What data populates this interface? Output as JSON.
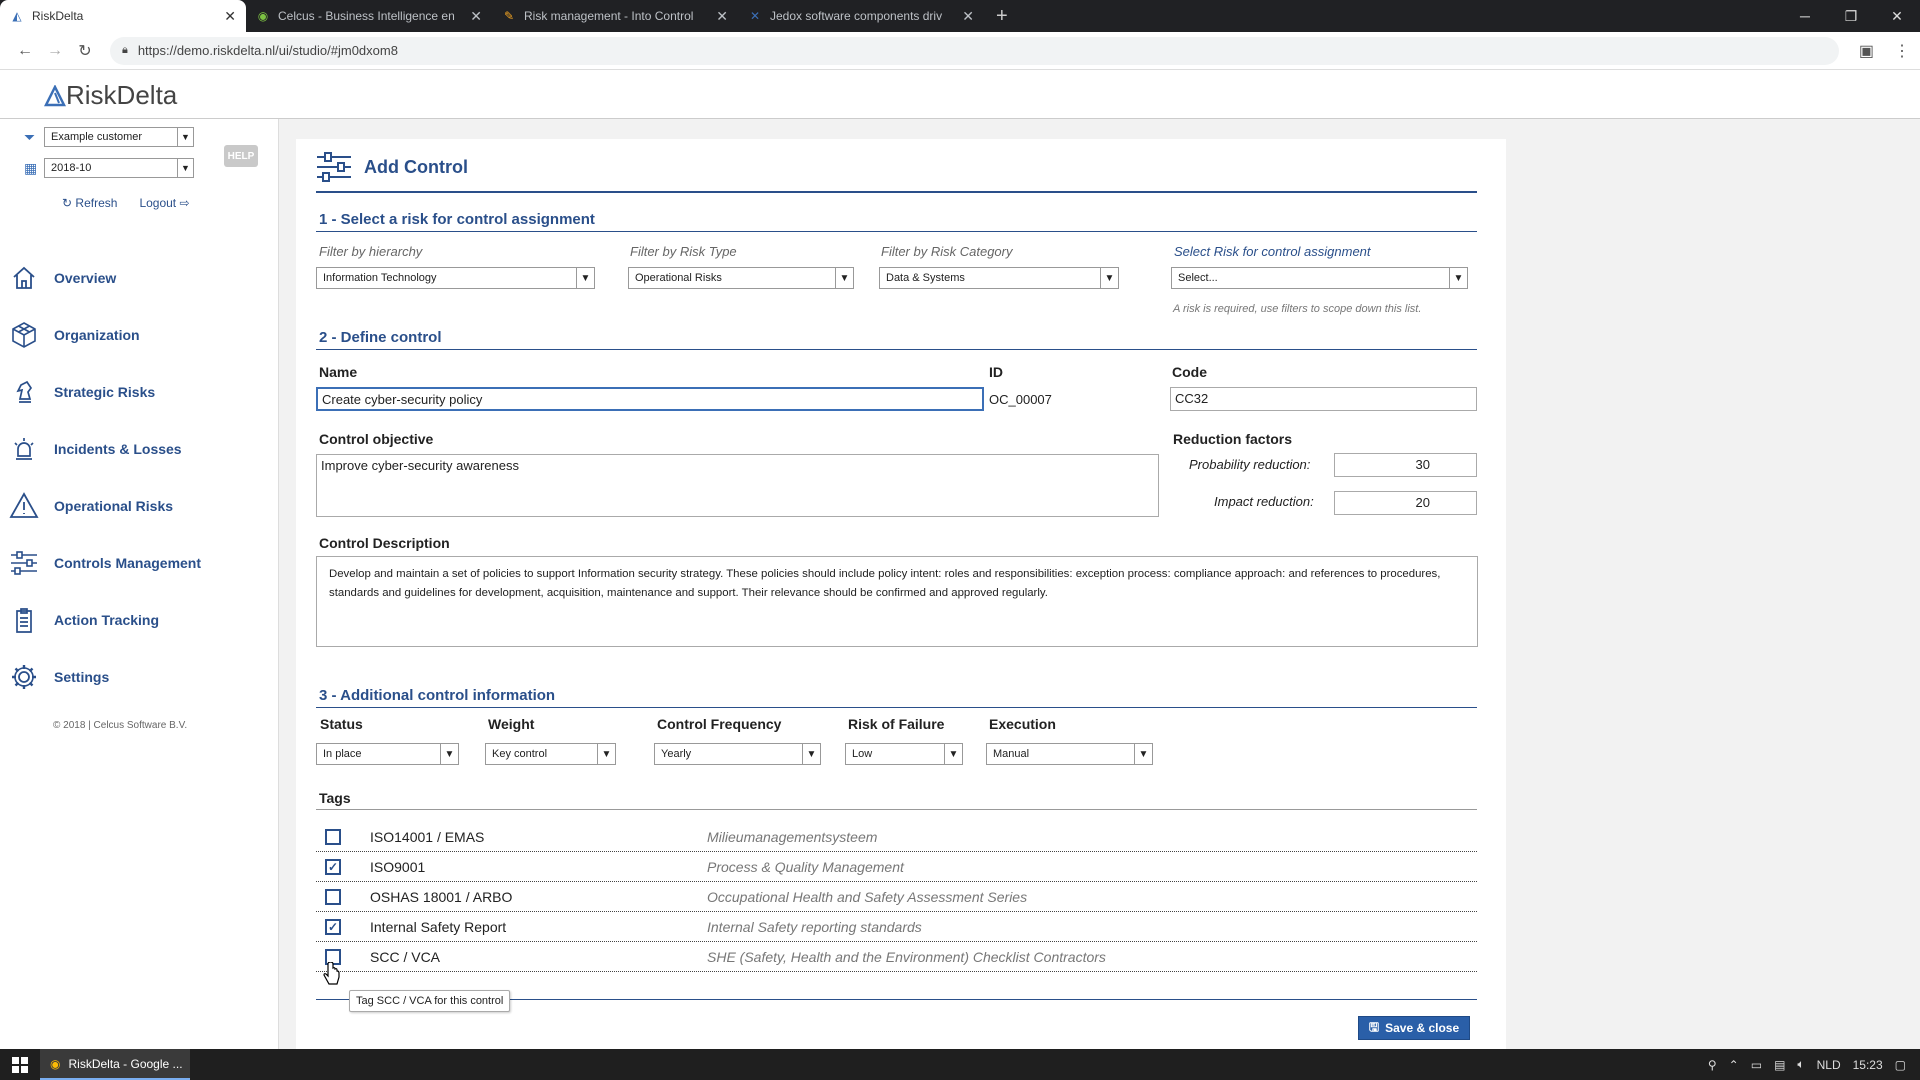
{
  "browser": {
    "tabs": [
      {
        "title": "RiskDelta",
        "active": true
      },
      {
        "title": "Celcus - Business Intelligence en",
        "active": false
      },
      {
        "title": "Risk management - Into Control",
        "active": false
      },
      {
        "title": "Jedox software components driv",
        "active": false
      }
    ],
    "url": "https://demo.riskdelta.nl/ui/studio/#jm0dxom8"
  },
  "app": {
    "logo": "RiskDelta",
    "customer_select": "Example customer",
    "period_select": "2018-10",
    "help_label": "HELP",
    "refresh_label": "Refresh",
    "logout_label": "Logout",
    "nav": [
      {
        "label": "Overview",
        "icon": "home-icon"
      },
      {
        "label": "Organization",
        "icon": "cube-icon"
      },
      {
        "label": "Strategic Risks",
        "icon": "chess-knight-icon"
      },
      {
        "label": "Incidents & Losses",
        "icon": "alarm-light-icon"
      },
      {
        "label": "Operational Risks",
        "icon": "warning-icon"
      },
      {
        "label": "Controls Management",
        "icon": "sliders-icon"
      },
      {
        "label": "Action Tracking",
        "icon": "clipboard-icon"
      },
      {
        "label": "Settings",
        "icon": "gear-icon"
      }
    ],
    "copyright": "© 2018 | Celcus Software B.V."
  },
  "form": {
    "title": "Add Control",
    "section1": {
      "heading": "1 - Select a risk for control assignment",
      "filter_hierarchy_label": "Filter by hierarchy",
      "filter_hierarchy_value": "Information Technology",
      "filter_type_label": "Filter by Risk Type",
      "filter_type_value": "Operational Risks",
      "filter_category_label": "Filter by Risk Category",
      "filter_category_value": "Data & Systems",
      "select_risk_label": "Select Risk for control assignment",
      "select_risk_value": "Select...",
      "note": "A risk is required, use filters to scope down this list."
    },
    "section2": {
      "heading": "2 - Define control",
      "name_label": "Name",
      "name_value": "Create cyber-security policy",
      "id_label": "ID",
      "id_value": "OC_00007",
      "code_label": "Code",
      "code_value": "CC32",
      "objective_label": "Control objective",
      "objective_value": "Improve cyber-security awareness",
      "reduction_label": "Reduction factors",
      "prob_label": "Probability reduction:",
      "prob_value": "30",
      "impact_label": "Impact reduction:",
      "impact_value": "20",
      "description_label": "Control Description",
      "description_value": "Develop and maintain a set of policies to support Information security strategy. These policies should include policy intent: roles and responsibilities: exception process: compliance approach: and references to procedures, standards and guidelines for development, acquisition, maintenance and support. Their relevance should be confirmed and approved regularly."
    },
    "section3": {
      "heading": "3 - Additional control information",
      "status_label": "Status",
      "status_value": "In place",
      "weight_label": "Weight",
      "weight_value": "Key control",
      "frequency_label": "Control Frequency",
      "frequency_value": "Yearly",
      "failure_label": "Risk of Failure",
      "failure_value": "Low",
      "execution_label": "Execution",
      "execution_value": "Manual",
      "tags_label": "Tags",
      "tags": [
        {
          "name": "ISO14001 / EMAS",
          "desc": "Milieumanagementsysteem",
          "checked": false
        },
        {
          "name": "ISO9001",
          "desc": "Process & Quality Management",
          "checked": true
        },
        {
          "name": "OSHAS 18001 / ARBO",
          "desc": "Occupational Health and Safety Assessment Series",
          "checked": false
        },
        {
          "name": "Internal Safety Report",
          "desc": "Internal Safety reporting standards",
          "checked": true
        },
        {
          "name": "SCC / VCA",
          "desc": "SHE (Safety, Health and the Environment) Checklist Contractors",
          "checked": false
        }
      ],
      "tooltip": "Tag SCC / VCA for this control"
    },
    "save_label": "Save & close"
  },
  "taskbar": {
    "app_label": "RiskDelta - Google ...",
    "lang": "NLD",
    "time": "15:23"
  },
  "colors": {
    "accent": "#2a4f8a",
    "button": "#2a5fa8"
  }
}
